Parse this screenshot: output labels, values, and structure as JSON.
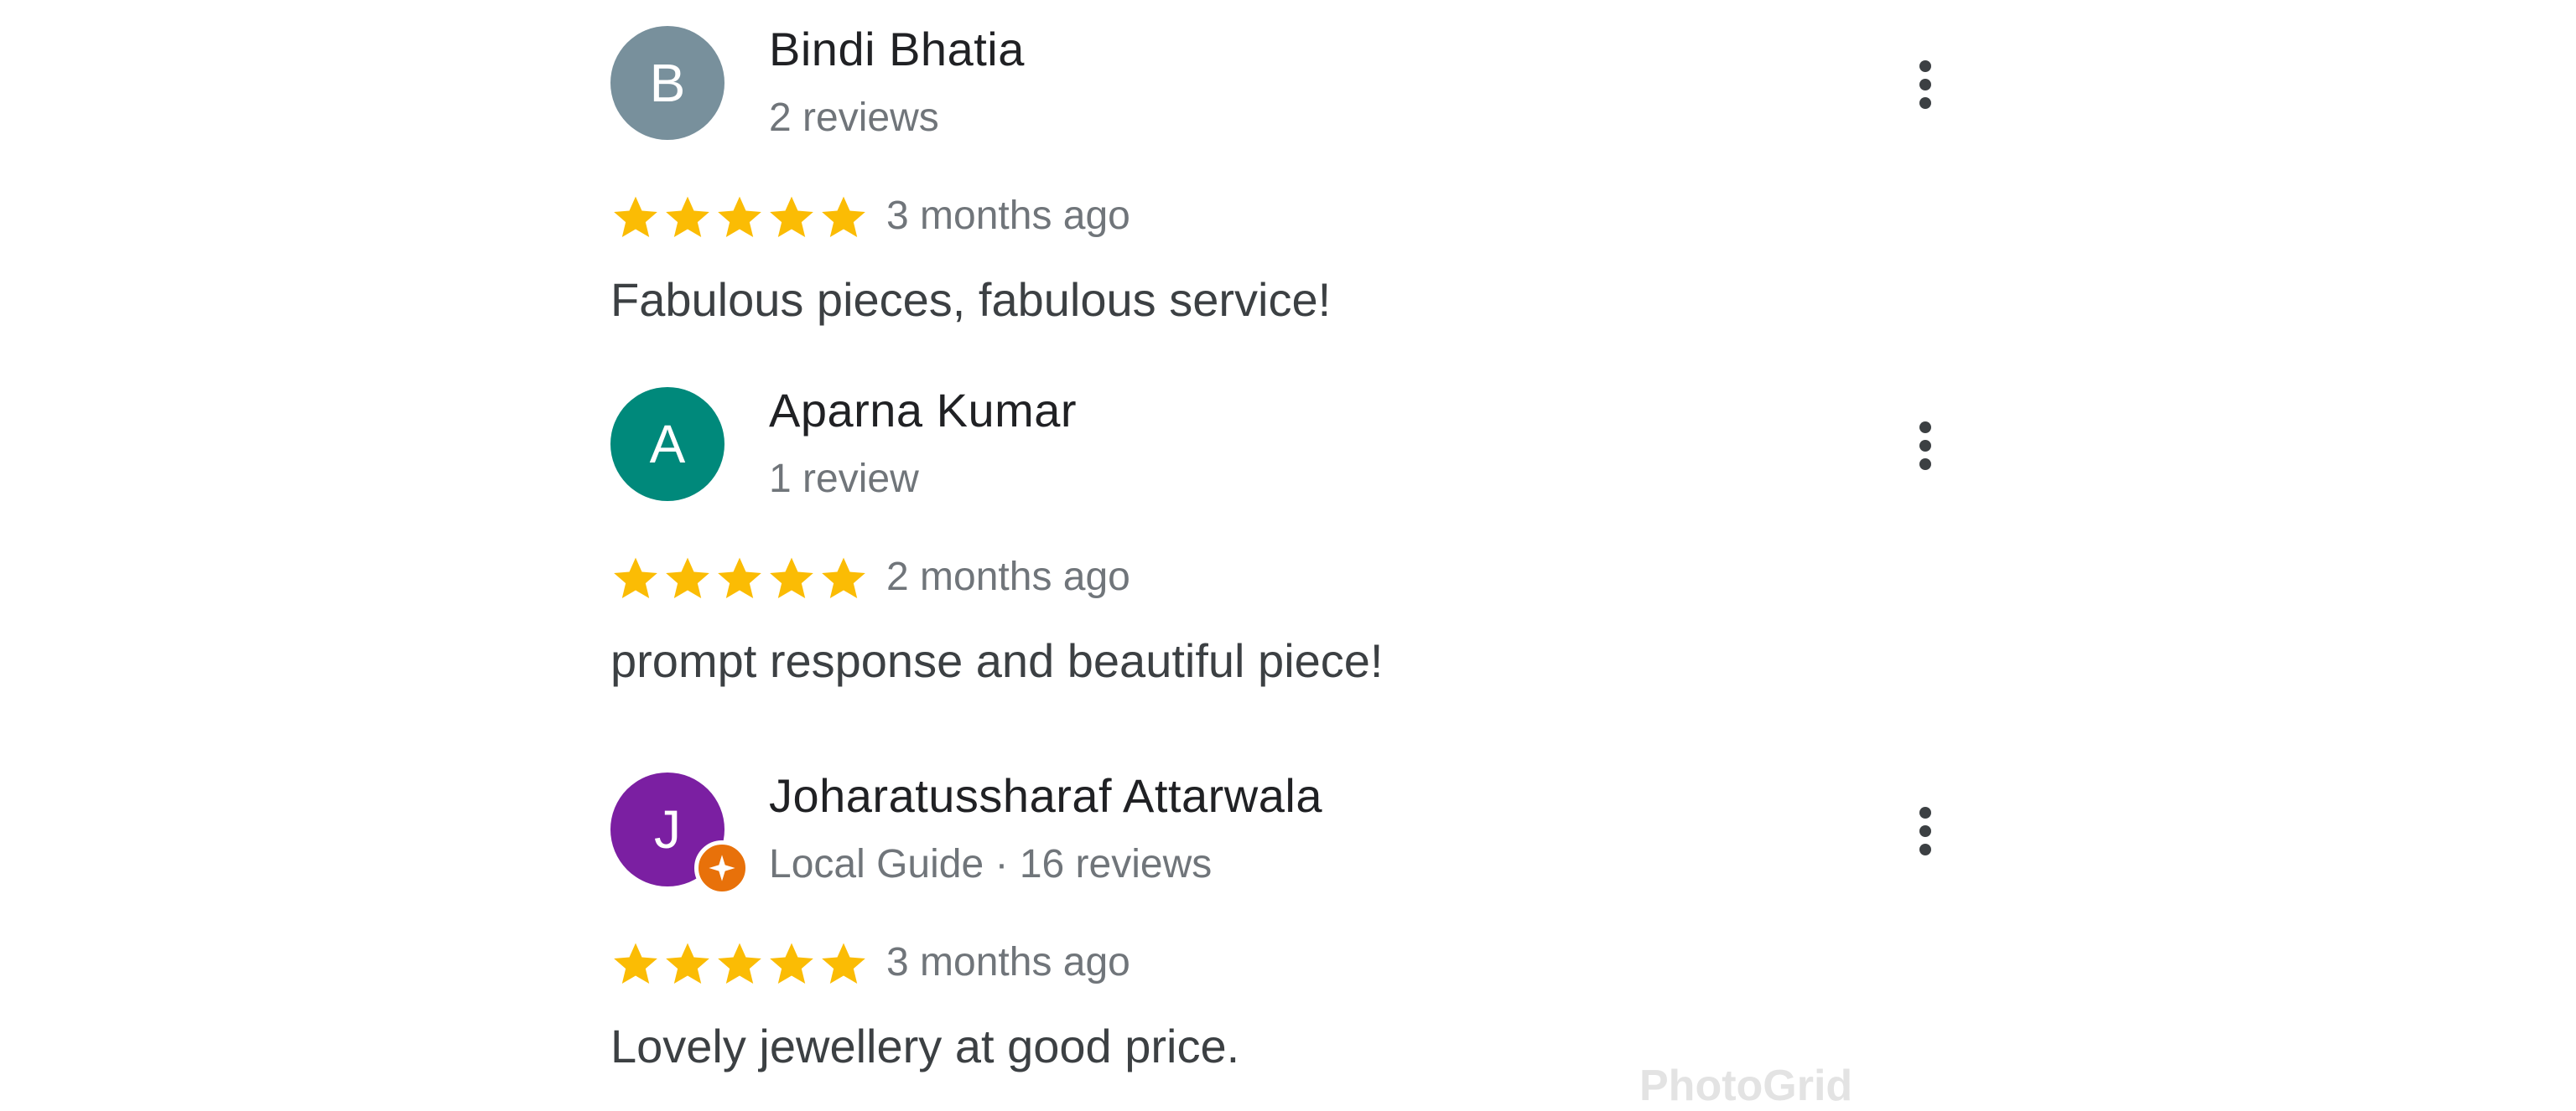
{
  "reviews": [
    {
      "initial": "B",
      "avatar_color": "#78909c",
      "name": "Bindi Bhatia",
      "subtitle": "2 reviews",
      "rating": 5,
      "time": "3 months ago",
      "text": "Fabulous pieces, fabulous service!",
      "local_guide": false
    },
    {
      "initial": "A",
      "avatar_color": "#00897b",
      "name": "Aparna Kumar",
      "subtitle": "1 review",
      "rating": 5,
      "time": "2 months ago",
      "text": "prompt response and beautiful piece!",
      "local_guide": false
    },
    {
      "initial": "J",
      "avatar_color": "#7b1fa2",
      "name": "Joharatussharaf Attarwala",
      "subtitle": "Local Guide · 16 reviews",
      "rating": 5,
      "time": "3 months ago",
      "text": "Lovely jewellery at good price.",
      "local_guide": true
    }
  ],
  "colors": {
    "star": "#fbbc04",
    "local_guide_badge": "#e8710a"
  },
  "icons": {
    "more": "more-vert-icon",
    "star": "star-icon",
    "badge": "local-guide-badge-icon"
  },
  "watermark": "PhotoGrid"
}
